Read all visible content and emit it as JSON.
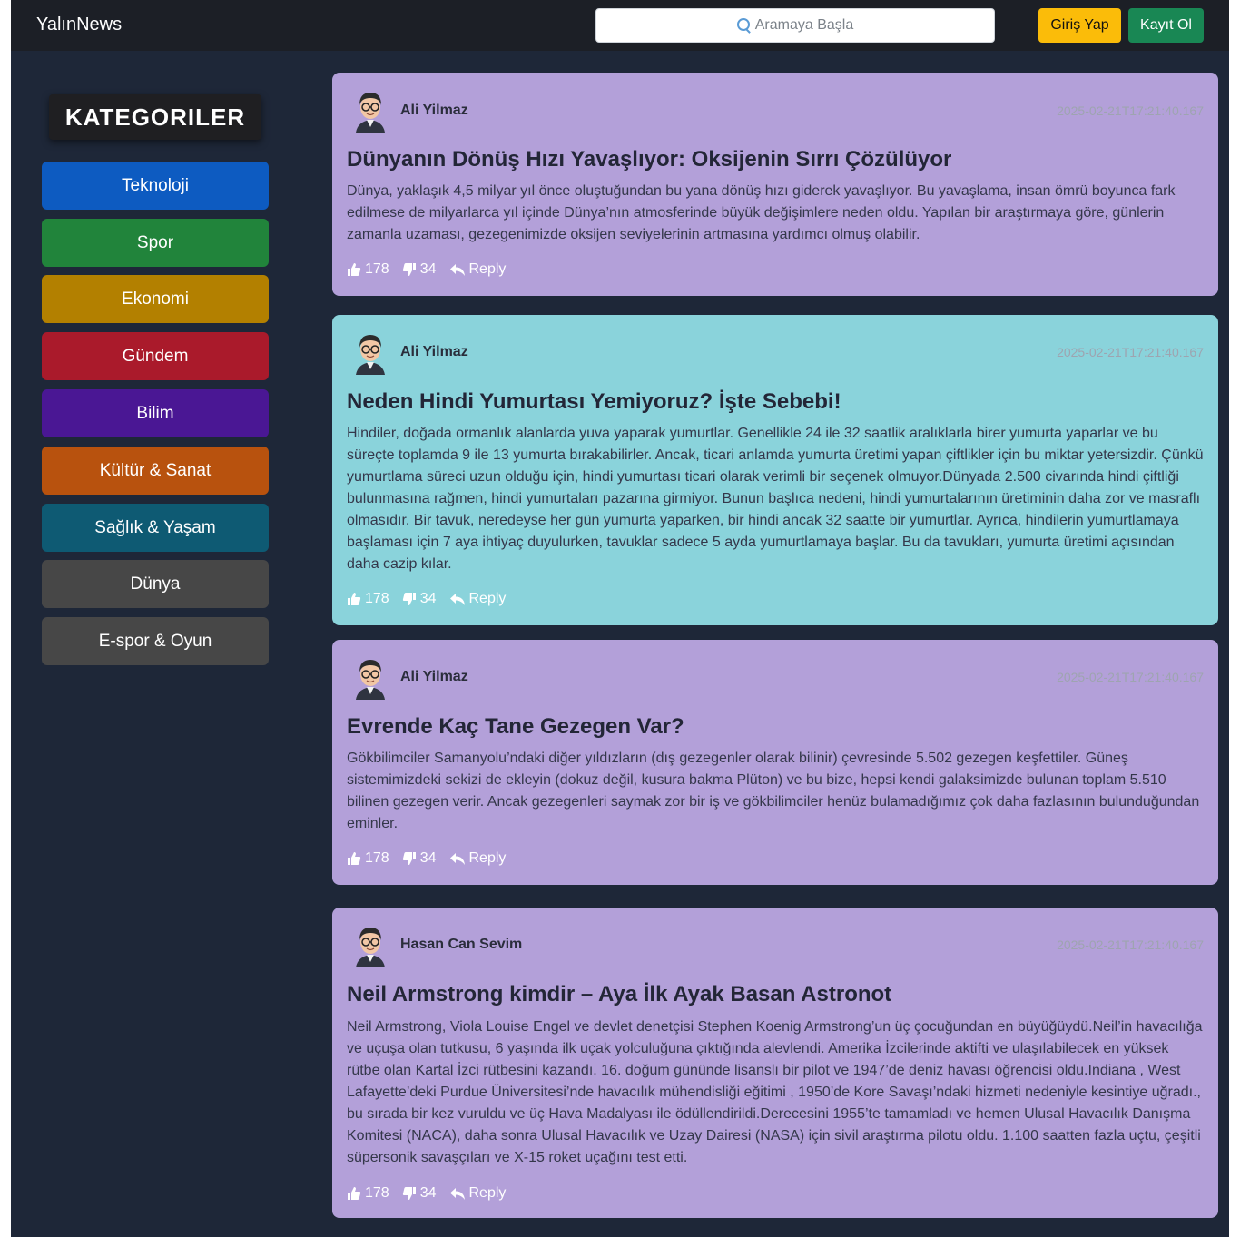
{
  "navbar": {
    "brand": "YalınNews",
    "search_placeholder": "Aramaya Başla",
    "login_label": "Giriş Yap",
    "register_label": "Kayıt Ol"
  },
  "sidebar": {
    "title": "KATEGORILER",
    "items": [
      {
        "label": "Teknoloji",
        "color": "#0d5bc1"
      },
      {
        "label": "Spor",
        "color": "#21843b"
      },
      {
        "label": "Ekonomi",
        "color": "#b38000"
      },
      {
        "label": "Gündem",
        "color": "#aa1a2b"
      },
      {
        "label": "Bilim",
        "color": "#4a1794"
      },
      {
        "label": "Kültür & Sanat",
        "color": "#b8520e"
      },
      {
        "label": "Sağlık & Yaşam",
        "color": "#0e5a73"
      },
      {
        "label": "Dünya",
        "color": "#474747"
      },
      {
        "label": "E-spor & Oyun",
        "color": "#474747"
      }
    ]
  },
  "posts": [
    {
      "author": "Ali Yilmaz",
      "timestamp": "2025-02-21T17:21:40.167",
      "title": "Dünyanın Dönüş Hızı Yavaşlıyor: Oksijenin Sırrı Çözülüyor",
      "body": "Dünya, yaklaşık 4,5 milyar yıl önce oluştuğundan bu yana dönüş hızı giderek yavaşlıyor. Bu yavaşlama, insan ömrü boyunca fark edilmese de milyarlarca yıl içinde Dünya’nın atmosferinde büyük değişimlere neden oldu. Yapılan bir araştırmaya göre, günlerin zamanla uzaması, gezegenimizde oksijen seviyelerinin artmasına yardımcı olmuş olabilir.",
      "likes": "178",
      "dislikes": "34",
      "reply_label": "Reply",
      "color": "#b3a0d9"
    },
    {
      "author": "Ali Yilmaz",
      "timestamp": "2025-02-21T17:21:40.167",
      "title": "Neden Hindi Yumurtası Yemiyoruz? İşte Sebebi!",
      "body": "Hindiler, doğada ormanlık alanlarda yuva yaparak yumurtlar. Genellikle 24 ile 32 saatlik aralıklarla birer yumurta yaparlar ve bu süreçte toplamda 9 ile 13 yumurta bırakabilirler. Ancak, ticari anlamda yumurta üretimi yapan çiftlikler için bu miktar yetersizdir. Çünkü yumurtlama süreci uzun olduğu için, hindi yumurtası ticari olarak verimli bir seçenek olmuyor.Dünyada 2.500 civarında hindi çiftliği bulunmasına rağmen, hindi yumurtaları pazarına girmiyor. Bunun başlıca nedeni, hindi yumurtalarının üretiminin daha zor ve masraflı olmasıdır. Bir tavuk, neredeyse her gün yumurta yaparken, bir hindi ancak 32 saatte bir yumurtlar. Ayrıca, hindilerin yumurtlamaya başlaması için 7 aya ihtiyaç duyulurken, tavuklar sadece 5 ayda yumurtlamaya başlar. Bu da tavukları, yumurta üretimi açısından daha cazip kılar.",
      "likes": "178",
      "dislikes": "34",
      "reply_label": "Reply",
      "color": "#8ad3db"
    },
    {
      "author": "Ali Yilmaz",
      "timestamp": "2025-02-21T17:21:40.167",
      "title": "Evrende Kaç Tane Gezegen Var?",
      "body": "Gökbilimciler Samanyolu’ndaki diğer yıldızların (dış gezegenler olarak bilinir) çevresinde 5.502 gezegen keşfettiler. Güneş sistemimizdeki sekizi de ekleyin (dokuz değil, kusura bakma Plüton) ve bu bize, hepsi kendi galaksimizde bulunan toplam 5.510 bilinen gezegen verir. Ancak gezegenleri saymak zor bir iş ve gökbilimciler henüz bulamadığımız çok daha fazlasının bulunduğundan eminler.",
      "likes": "178",
      "dislikes": "34",
      "reply_label": "Reply",
      "color": "#b3a0d9"
    },
    {
      "author": "Hasan Can Sevim",
      "timestamp": "2025-02-21T17:21:40.167",
      "title": "Neil Armstrong kimdir – Aya İlk Ayak Basan Astronot",
      "body": "Neil Armstrong, Viola Louise Engel ve devlet denetçisi Stephen Koenig Armstrong’un üç çocuğundan en büyüğüydü.Neil’in havacılığa ve uçuşa olan tutkusu, 6 yaşında ilk uçak yolculuğuna çıktığında alevlendi. Amerika İzcilerinde aktifti ve ulaşılabilecek en yüksek rütbe olan Kartal İzci rütbesini kazandı. 16. doğum gününde lisanslı bir pilot ve 1947’de deniz havası öğrencisi oldu.Indiana , West Lafayette’deki Purdue Üniversitesi’nde havacılık mühendisliği eğitimi , 1950’de Kore Savaşı’ndaki hizmeti nedeniyle kesintiye uğradı., bu sırada bir kez vuruldu ve üç Hava Madalyası ile ödüllendirildi.Derecesini 1955’te tamamladı ve hemen Ulusal Havacılık Danışma Komitesi (NACA), daha sonra Ulusal Havacılık ve Uzay Dairesi (NASA) için sivil araştırma pilotu oldu. 1.100 saatten fazla uçtu, çeşitli süpersonik savaşçıları ve X-15 roket uçağını test etti.",
      "likes": "178",
      "dislikes": "34",
      "reply_label": "Reply",
      "color": "#b3a0d9"
    }
  ]
}
